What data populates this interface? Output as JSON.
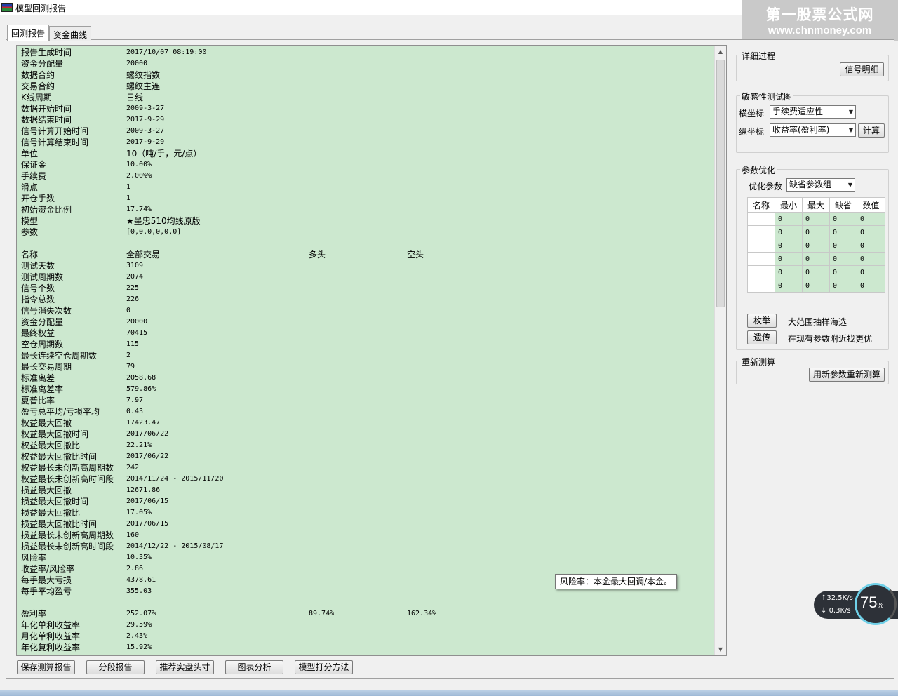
{
  "window": {
    "title": "模型回测报告"
  },
  "watermark": {
    "line1": "第一股票公式网",
    "line2": "www.chnmoney.com"
  },
  "tabs": [
    {
      "label": "回测报告",
      "active": true
    },
    {
      "label": "资金曲线",
      "active": false
    }
  ],
  "report": {
    "info": [
      {
        "label": "报告生成时间",
        "value": "2017/10/07 08:19:00"
      },
      {
        "label": "资金分配量",
        "value": "20000"
      },
      {
        "label": "数据合约",
        "value": "螺纹指数"
      },
      {
        "label": "交易合约",
        "value": "螺纹主连"
      },
      {
        "label": "K线周期",
        "value": "日线"
      },
      {
        "label": "数据开始时间",
        "value": "2009-3-27"
      },
      {
        "label": "数据结束时间",
        "value": "2017-9-29"
      },
      {
        "label": "信号计算开始时间",
        "value": "2009-3-27"
      },
      {
        "label": "信号计算结束时间",
        "value": "2017-9-29"
      },
      {
        "label": "单位",
        "value": "10（吨/手，元/点）"
      },
      {
        "label": "保证金",
        "value": "10.00%"
      },
      {
        "label": "手续费",
        "value": "2.00%%"
      },
      {
        "label": "滑点",
        "value": "1"
      },
      {
        "label": "开仓手数",
        "value": "1"
      },
      {
        "label": "初始资金比例",
        "value": "17.74%"
      },
      {
        "label": "模型",
        "value": "★墨忠510均线原版"
      },
      {
        "label": "参数",
        "value": "[0,0,0,0,0,0]"
      }
    ],
    "stats_header": {
      "name": "名称",
      "all": "全部交易",
      "long": "多头",
      "short": "空头"
    },
    "stats": [
      {
        "label": "测试天数",
        "value": "3109"
      },
      {
        "label": "测试周期数",
        "value": "2074"
      },
      {
        "label": "信号个数",
        "value": "225"
      },
      {
        "label": "指令总数",
        "value": "226"
      },
      {
        "label": "信号消失次数",
        "value": "0"
      },
      {
        "label": "资金分配量",
        "value": "20000"
      },
      {
        "label": "最终权益",
        "value": "70415"
      },
      {
        "label": "空仓周期数",
        "value": "115"
      },
      {
        "label": "最长连续空仓周期数",
        "value": "2"
      },
      {
        "label": "最长交易周期",
        "value": "79"
      },
      {
        "label": "标准离差",
        "value": "2058.68"
      },
      {
        "label": "标准离差率",
        "value": "579.86%"
      },
      {
        "label": "夏普比率",
        "value": "7.97"
      },
      {
        "label": "盈亏总平均/亏损平均",
        "value": "0.43"
      },
      {
        "label": "权益最大回撤",
        "value": "17423.47"
      },
      {
        "label": "权益最大回撤时间",
        "value": "2017/06/22"
      },
      {
        "label": "权益最大回撤比",
        "value": "22.21%"
      },
      {
        "label": "权益最大回撤比时间",
        "value": "2017/06/22"
      },
      {
        "label": "权益最长未创新高周期数",
        "value": "242"
      },
      {
        "label": "权益最长未创新高时间段",
        "value": "2014/11/24 - 2015/11/20"
      },
      {
        "label": "损益最大回撤",
        "value": "12671.86"
      },
      {
        "label": "损益最大回撤时间",
        "value": "2017/06/15"
      },
      {
        "label": "损益最大回撤比",
        "value": "17.05%"
      },
      {
        "label": "损益最大回撤比时间",
        "value": "2017/06/15"
      },
      {
        "label": "损益最长未创新高周期数",
        "value": "160"
      },
      {
        "label": "损益最长未创新高时间段",
        "value": "2014/12/22 - 2015/08/17"
      },
      {
        "label": "风险率",
        "value": "10.35%"
      },
      {
        "label": "收益率/风险率",
        "value": "2.86"
      },
      {
        "label": "每手最大亏损",
        "value": "4378.61"
      },
      {
        "label": "每手平均盈亏",
        "value": "355.03"
      }
    ],
    "returns": [
      {
        "label": "盈利率",
        "all": "252.07%",
        "long": "89.74%",
        "short": "162.34%"
      },
      {
        "label": "年化单利收益率",
        "all": "29.59%",
        "long": "",
        "short": ""
      },
      {
        "label": "月化单利收益率",
        "all": "2.43%",
        "long": "",
        "short": ""
      },
      {
        "label": "年化复利收益率",
        "all": "15.92%",
        "long": "",
        "short": ""
      }
    ],
    "tooltip": "风险率：本金最大回调/本金。"
  },
  "bottom_buttons": [
    "保存测算报告",
    "分段报告",
    "推荐实盘头寸",
    "图表分析",
    "模型打分方法"
  ],
  "right_panel": {
    "detail": {
      "title": "详细过程",
      "button": "信号明细"
    },
    "sensitivity": {
      "title": "敏感性测试图",
      "x_label": "横坐标",
      "x_value": "手续费适应性",
      "y_label": "纵坐标",
      "y_value": "收益率(盈利率)",
      "calc_button": "计算"
    },
    "optimization": {
      "title": "参数优化",
      "param_label": "优化参数",
      "param_value": "缺省参数组",
      "table_headers": [
        "名称",
        "最小",
        "最大",
        "缺省",
        "数值"
      ],
      "table_rows": [
        [
          "",
          "0",
          "0",
          "0",
          "0"
        ],
        [
          "",
          "0",
          "0",
          "0",
          "0"
        ],
        [
          "",
          "0",
          "0",
          "0",
          "0"
        ],
        [
          "",
          "0",
          "0",
          "0",
          "0"
        ],
        [
          "",
          "0",
          "0",
          "0",
          "0"
        ],
        [
          "",
          "0",
          "0",
          "0",
          "0"
        ]
      ],
      "enum_button": "枚举",
      "enum_desc": "大范围抽样海选",
      "genetic_button": "遗传",
      "genetic_desc": "在现有参数附近找更优"
    },
    "recalc": {
      "title": "重新测算",
      "button": "用新参数重新测算"
    }
  },
  "network": {
    "up": "32.5K/s",
    "down": "0.3K/s",
    "percent": "75",
    "percent_unit": "%"
  }
}
